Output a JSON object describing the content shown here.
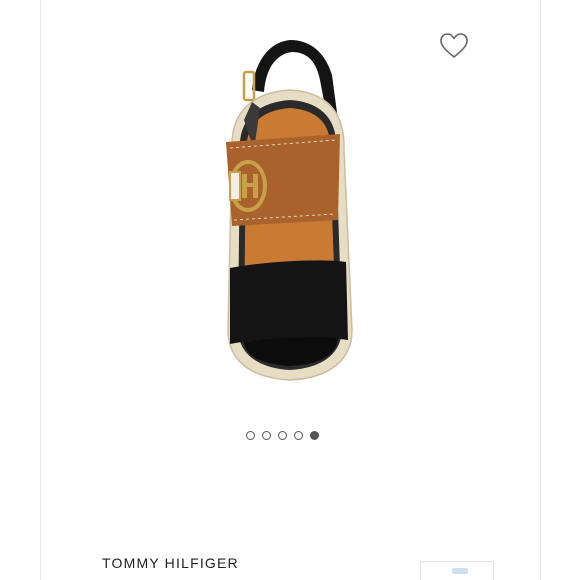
{
  "product": {
    "brand": "TOMMY HILFIGER",
    "image_icon": "sandal-image",
    "favorite_icon": "heart-outline-icon"
  },
  "carousel": {
    "total": 5,
    "active_index": 4
  },
  "colors": {
    "strap_tan": "#a9622b",
    "strap_black": "#141414",
    "buckle_gold": "#c9a04a",
    "footbed": "#c97b34",
    "rope_sole": "#e7dcc4",
    "dot": "#555555"
  }
}
